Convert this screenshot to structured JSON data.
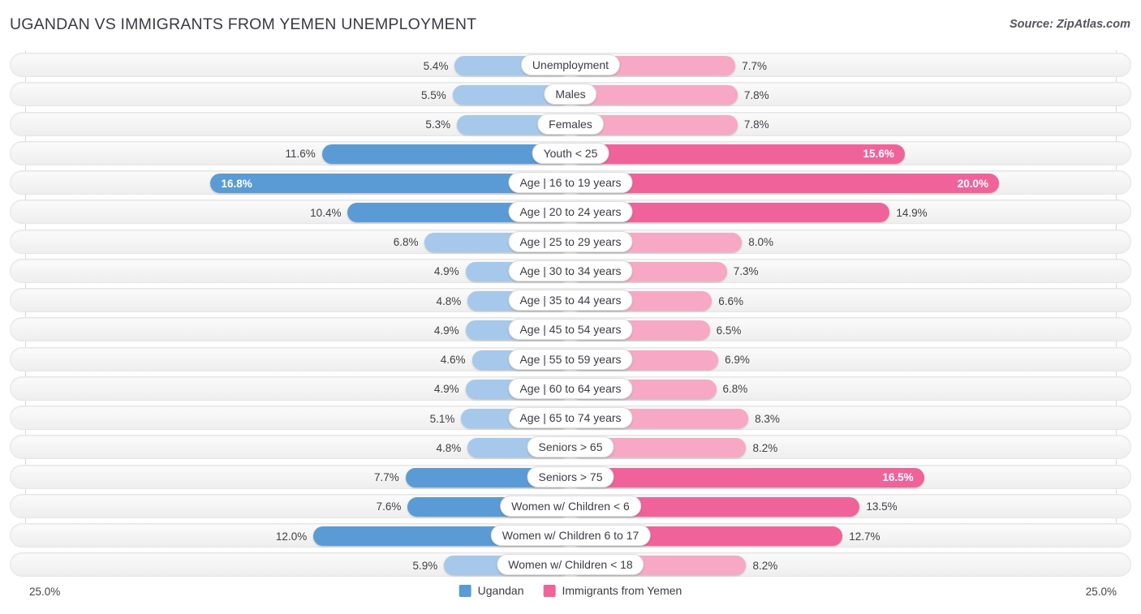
{
  "header": {
    "title": "UGANDAN VS IMMIGRANTS FROM YEMEN UNEMPLOYMENT",
    "source": "Source: ZipAtlas.com"
  },
  "axis": {
    "min_label": "25.0%",
    "max_label": "25.0%"
  },
  "legend": {
    "items": [
      {
        "label": "Ugandan",
        "color": "#5b9bd5"
      },
      {
        "label": "Immigrants from Yemen",
        "color": "#f0639a"
      }
    ]
  },
  "colors": {
    "blue_light": "#a6c8ea",
    "blue_dark": "#5b9bd5",
    "pink_light": "#f7a8c4",
    "pink_dark": "#f0639a",
    "row_bg": "#f4f4f4",
    "text": "#3f3f46"
  },
  "chart_data": {
    "type": "bar",
    "title": "UGANDAN VS IMMIGRANTS FROM YEMEN UNEMPLOYMENT",
    "subtitle": "Source: ZipAtlas.com",
    "orientation": "horizontal-diverging",
    "xlabel": "",
    "ylabel": "",
    "xlim": [
      -25.0,
      25.0
    ],
    "axis_min_label": "25.0%",
    "axis_max_label": "25.0%",
    "grid": false,
    "legend_position": "bottom-center",
    "categories": [
      "Unemployment",
      "Males",
      "Females",
      "Youth < 25",
      "Age | 16 to 19 years",
      "Age | 20 to 24 years",
      "Age | 25 to 29 years",
      "Age | 30 to 34 years",
      "Age | 35 to 44 years",
      "Age | 45 to 54 years",
      "Age | 55 to 59 years",
      "Age | 60 to 64 years",
      "Age | 65 to 74 years",
      "Seniors > 65",
      "Seniors > 75",
      "Women w/ Children < 6",
      "Women w/ Children 6 to 17",
      "Women w/ Children < 18"
    ],
    "series": [
      {
        "name": "Ugandan",
        "color": "#5b9bd5",
        "values": [
          5.4,
          5.5,
          5.3,
          11.6,
          16.8,
          10.4,
          6.8,
          4.9,
          4.8,
          4.9,
          4.6,
          4.9,
          5.1,
          4.8,
          7.7,
          7.6,
          12.0,
          5.9
        ],
        "labels": [
          "5.4%",
          "5.5%",
          "5.3%",
          "11.6%",
          "16.8%",
          "10.4%",
          "6.8%",
          "4.9%",
          "4.8%",
          "4.9%",
          "4.6%",
          "4.9%",
          "5.1%",
          "4.8%",
          "7.7%",
          "7.6%",
          "12.0%",
          "5.9%"
        ]
      },
      {
        "name": "Immigrants from Yemen",
        "color": "#f0639a",
        "values": [
          7.7,
          7.8,
          7.8,
          15.6,
          20.0,
          14.9,
          8.0,
          7.3,
          6.6,
          6.5,
          6.9,
          6.8,
          8.3,
          8.2,
          16.5,
          13.5,
          12.7,
          8.2
        ],
        "labels": [
          "7.7%",
          "7.8%",
          "7.8%",
          "15.6%",
          "20.0%",
          "14.9%",
          "8.0%",
          "7.3%",
          "6.6%",
          "6.5%",
          "6.9%",
          "6.8%",
          "8.3%",
          "8.2%",
          "16.5%",
          "13.5%",
          "12.7%",
          "8.2%"
        ]
      }
    ]
  },
  "rows": [
    {
      "label": "Unemployment",
      "left": {
        "label": "5.4%",
        "value": 5.4,
        "inside": false,
        "emphasis": false
      },
      "right": {
        "label": "7.7%",
        "value": 7.7,
        "inside": false,
        "emphasis": false
      }
    },
    {
      "label": "Males",
      "left": {
        "label": "5.5%",
        "value": 5.5,
        "inside": false,
        "emphasis": false
      },
      "right": {
        "label": "7.8%",
        "value": 7.8,
        "inside": false,
        "emphasis": false
      }
    },
    {
      "label": "Females",
      "left": {
        "label": "5.3%",
        "value": 5.3,
        "inside": false,
        "emphasis": false
      },
      "right": {
        "label": "7.8%",
        "value": 7.8,
        "inside": false,
        "emphasis": false
      }
    },
    {
      "label": "Youth < 25",
      "left": {
        "label": "11.6%",
        "value": 11.6,
        "inside": false,
        "emphasis": true
      },
      "right": {
        "label": "15.6%",
        "value": 15.6,
        "inside": true,
        "emphasis": true
      }
    },
    {
      "label": "Age | 16 to 19 years",
      "left": {
        "label": "16.8%",
        "value": 16.8,
        "inside": true,
        "emphasis": true
      },
      "right": {
        "label": "20.0%",
        "value": 20.0,
        "inside": true,
        "emphasis": true
      }
    },
    {
      "label": "Age | 20 to 24 years",
      "left": {
        "label": "10.4%",
        "value": 10.4,
        "inside": false,
        "emphasis": true
      },
      "right": {
        "label": "14.9%",
        "value": 14.9,
        "inside": false,
        "emphasis": true
      }
    },
    {
      "label": "Age | 25 to 29 years",
      "left": {
        "label": "6.8%",
        "value": 6.8,
        "inside": false,
        "emphasis": false
      },
      "right": {
        "label": "8.0%",
        "value": 8.0,
        "inside": false,
        "emphasis": false
      }
    },
    {
      "label": "Age | 30 to 34 years",
      "left": {
        "label": "4.9%",
        "value": 4.9,
        "inside": false,
        "emphasis": false
      },
      "right": {
        "label": "7.3%",
        "value": 7.3,
        "inside": false,
        "emphasis": false
      }
    },
    {
      "label": "Age | 35 to 44 years",
      "left": {
        "label": "4.8%",
        "value": 4.8,
        "inside": false,
        "emphasis": false
      },
      "right": {
        "label": "6.6%",
        "value": 6.6,
        "inside": false,
        "emphasis": false
      }
    },
    {
      "label": "Age | 45 to 54 years",
      "left": {
        "label": "4.9%",
        "value": 4.9,
        "inside": false,
        "emphasis": false
      },
      "right": {
        "label": "6.5%",
        "value": 6.5,
        "inside": false,
        "emphasis": false
      }
    },
    {
      "label": "Age | 55 to 59 years",
      "left": {
        "label": "4.6%",
        "value": 4.6,
        "inside": false,
        "emphasis": false
      },
      "right": {
        "label": "6.9%",
        "value": 6.9,
        "inside": false,
        "emphasis": false
      }
    },
    {
      "label": "Age | 60 to 64 years",
      "left": {
        "label": "4.9%",
        "value": 4.9,
        "inside": false,
        "emphasis": false
      },
      "right": {
        "label": "6.8%",
        "value": 6.8,
        "inside": false,
        "emphasis": false
      }
    },
    {
      "label": "Age | 65 to 74 years",
      "left": {
        "label": "5.1%",
        "value": 5.1,
        "inside": false,
        "emphasis": false
      },
      "right": {
        "label": "8.3%",
        "value": 8.3,
        "inside": false,
        "emphasis": false
      }
    },
    {
      "label": "Seniors > 65",
      "left": {
        "label": "4.8%",
        "value": 4.8,
        "inside": false,
        "emphasis": false
      },
      "right": {
        "label": "8.2%",
        "value": 8.2,
        "inside": false,
        "emphasis": false
      }
    },
    {
      "label": "Seniors > 75",
      "left": {
        "label": "7.7%",
        "value": 7.7,
        "inside": false,
        "emphasis": true
      },
      "right": {
        "label": "16.5%",
        "value": 16.5,
        "inside": true,
        "emphasis": true
      }
    },
    {
      "label": "Women w/ Children < 6",
      "left": {
        "label": "7.6%",
        "value": 7.6,
        "inside": false,
        "emphasis": true
      },
      "right": {
        "label": "13.5%",
        "value": 13.5,
        "inside": false,
        "emphasis": true
      }
    },
    {
      "label": "Women w/ Children 6 to 17",
      "left": {
        "label": "12.0%",
        "value": 12.0,
        "inside": false,
        "emphasis": true
      },
      "right": {
        "label": "12.7%",
        "value": 12.7,
        "inside": false,
        "emphasis": true
      }
    },
    {
      "label": "Women w/ Children < 18",
      "left": {
        "label": "5.9%",
        "value": 5.9,
        "inside": false,
        "emphasis": false
      },
      "right": {
        "label": "8.2%",
        "value": 8.2,
        "inside": false,
        "emphasis": false
      }
    }
  ]
}
